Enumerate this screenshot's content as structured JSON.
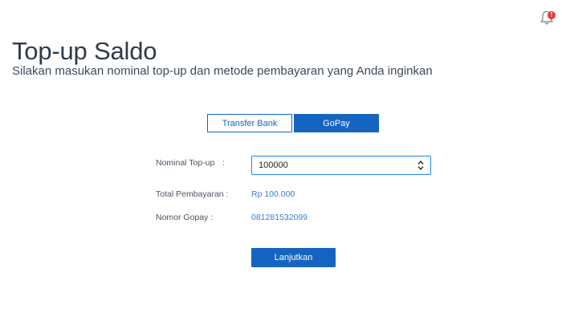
{
  "header": {
    "notification_icon": "bell-icon",
    "notification_badge": "!",
    "title": "Top-up Saldo",
    "subtitle": "Silakan masukan nominal top-up dan metode pembayaran yang Anda inginkan"
  },
  "tabs": [
    {
      "label": "Transfer Bank",
      "active": false
    },
    {
      "label": "GoPay",
      "active": true
    }
  ],
  "form": {
    "nominal_label": "Nominal Top-up",
    "nominal_colon": ":",
    "nominal_value": "100000",
    "total_label": "Total Pembayaran :",
    "total_value": "Rp 100.000",
    "gopay_label": "Nomor Gopay :",
    "gopay_value": "081281532099",
    "submit_label": "Lanjutkan"
  },
  "colors": {
    "accent": "#1565c0",
    "link_value": "#3a7bd5",
    "badge": "#e53935"
  }
}
